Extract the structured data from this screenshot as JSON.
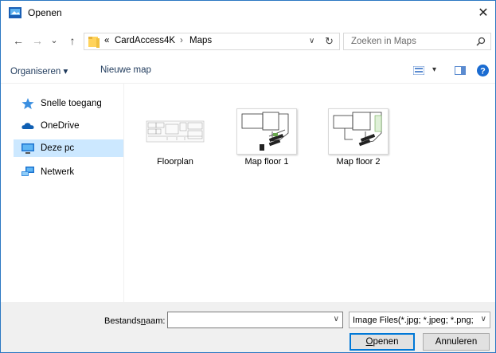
{
  "window": {
    "title": "Openen",
    "close_glyph": "✕"
  },
  "nav": {
    "back": "←",
    "forward": "→",
    "recent": "⌄",
    "up": "↑",
    "breadcrumb": {
      "prefix": "«",
      "items": [
        "CardAccess4K",
        "Maps"
      ],
      "separator": "›"
    },
    "address_dropdown": "∨",
    "refresh": "↻",
    "search_placeholder": "Zoeken in Maps"
  },
  "commands": {
    "organize": "Organiseren ▾",
    "new_folder": "Nieuwe map",
    "view_dropdown": "▾"
  },
  "sidebar": {
    "items": [
      {
        "label": "Snelle toegang",
        "icon": "star-icon"
      },
      {
        "label": "OneDrive",
        "icon": "cloud-icon"
      },
      {
        "label": "Deze pc",
        "icon": "monitor-icon",
        "selected": true
      },
      {
        "label": "Netwerk",
        "icon": "network-icon"
      }
    ]
  },
  "files": [
    {
      "name": "Floorplan"
    },
    {
      "name": "Map floor 1"
    },
    {
      "name": "Map floor 2"
    }
  ],
  "bottom": {
    "filename_label_pre": "Bestands",
    "filename_label_u": "n",
    "filename_label_post": "aam:",
    "filename_value": "",
    "filter": "Image Files(*.jpg; *.jpeg; *.png;",
    "dropdown_glyph": "∨",
    "open_u": "O",
    "open_rest": "penen",
    "cancel": "Annuleren"
  },
  "colors": {
    "accent": "#0078d7",
    "selected": "#cce8ff",
    "link": "#1e395b"
  }
}
